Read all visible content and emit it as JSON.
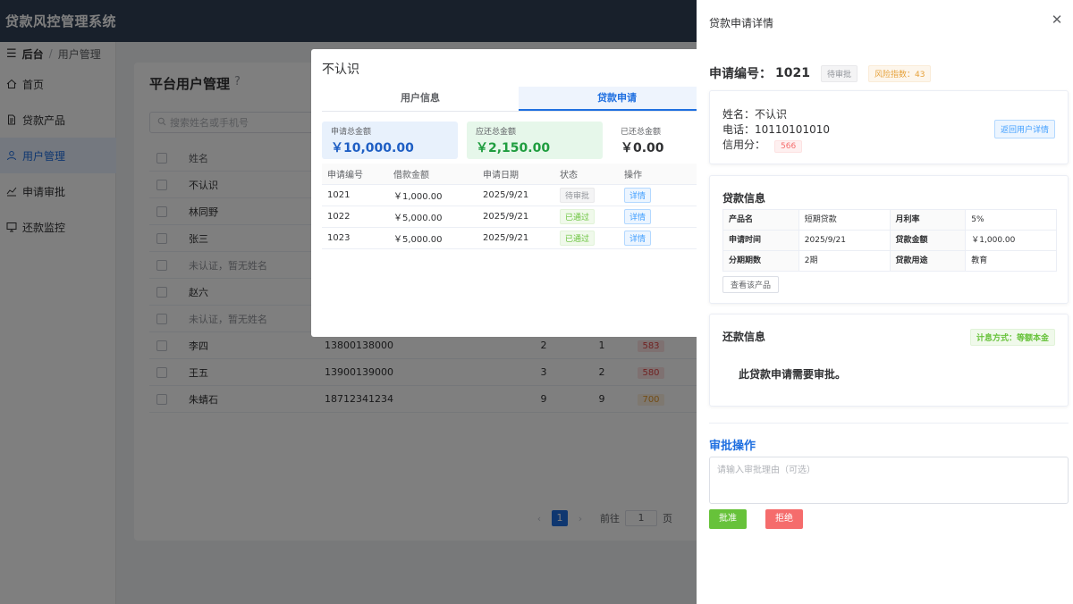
{
  "app": {
    "title": "贷款风控管理系统"
  },
  "breadcrumb": {
    "root": "后台",
    "current": "用户管理"
  },
  "nav": {
    "items": [
      {
        "label": "首页",
        "icon": "home-icon"
      },
      {
        "label": "贷款产品",
        "icon": "document-icon"
      },
      {
        "label": "用户管理",
        "icon": "user-icon"
      },
      {
        "label": "申请审批",
        "icon": "chart-icon"
      },
      {
        "label": "还款监控",
        "icon": "monitor-icon"
      }
    ]
  },
  "main": {
    "title": "平台用户管理",
    "search_placeholder": "搜索姓名或手机号",
    "header": {
      "name": "姓名"
    },
    "rows": [
      {
        "name": "不认识",
        "phone": "",
        "apps": "",
        "done": "",
        "score": ""
      },
      {
        "name": "林同野",
        "phone": "",
        "apps": "",
        "done": "",
        "score": ""
      },
      {
        "name": "张三",
        "phone": "",
        "apps": "",
        "done": "",
        "score": ""
      },
      {
        "name": "未认证，暂无姓名",
        "phone": "",
        "apps": "",
        "done": "",
        "score": ""
      },
      {
        "name": "赵六",
        "phone": "",
        "apps": "",
        "done": "",
        "score": ""
      },
      {
        "name": "未认证，暂无姓名",
        "phone": "",
        "apps": "",
        "done": "",
        "score": ""
      },
      {
        "name": "李四",
        "phone": "13800138000",
        "apps": "2",
        "done": "1",
        "score": "583"
      },
      {
        "name": "王五",
        "phone": "13900139000",
        "apps": "3",
        "done": "2",
        "score": "580"
      },
      {
        "name": "朱蜻石",
        "phone": "18712341234",
        "apps": "9",
        "done": "9",
        "score": "700"
      }
    ],
    "pager": {
      "current": "1",
      "goto_label": "前往",
      "goto_value": "1",
      "page_unit": "页"
    }
  },
  "modal": {
    "title": "不认识",
    "tabs": [
      "用户信息",
      "贷款申请"
    ],
    "stats": [
      {
        "label": "申请总金额",
        "value": "￥10,000.00"
      },
      {
        "label": "应还总金额",
        "value": "￥2,150.00"
      },
      {
        "label": "已还总金额",
        "value": "￥0.00"
      }
    ],
    "table": {
      "headers": [
        "申请编号",
        "借款金额",
        "申请日期",
        "状态",
        "操作"
      ],
      "rows": [
        {
          "id": "1021",
          "amount": "￥1,000.00",
          "date": "2025/9/21",
          "status": "待审批",
          "action": "详情"
        },
        {
          "id": "1022",
          "amount": "￥5,000.00",
          "date": "2025/9/21",
          "status": "已通过",
          "action": "详情"
        },
        {
          "id": "1023",
          "amount": "￥5,000.00",
          "date": "2025/9/21",
          "status": "已通过",
          "action": "详情"
        }
      ]
    }
  },
  "drawer": {
    "title": "贷款申请详情",
    "app_no_label": "申请编号：",
    "app_no": "1021",
    "status": "待审批",
    "risk": "风险指数：43",
    "user": {
      "name": "姓名：不认识",
      "phone": "电话：10110101010",
      "score_label": "信用分：",
      "score": "566",
      "back_button": "返回用户详情"
    },
    "loan": {
      "title": "贷款信息",
      "rows": [
        [
          {
            "k": "产品名",
            "v": "短期贷款"
          },
          {
            "k": "月利率",
            "v": "5%"
          }
        ],
        [
          {
            "k": "申请时间",
            "v": "2025/9/21"
          },
          {
            "k": "贷款金额",
            "v": "￥1,000.00"
          }
        ],
        [
          {
            "k": "分期期数",
            "v": "2期"
          },
          {
            "k": "贷款用途",
            "v": "教育"
          }
        ]
      ],
      "view_product": "查看该产品"
    },
    "repay": {
      "title": "还款信息",
      "method_tag": "计息方式：等额本金",
      "message": "此贷款申请需要审批。"
    },
    "approval": {
      "title": "审批操作",
      "reason_placeholder": "请输入审批理由（可选）",
      "approve": "批准",
      "reject": "拒绝"
    }
  }
}
